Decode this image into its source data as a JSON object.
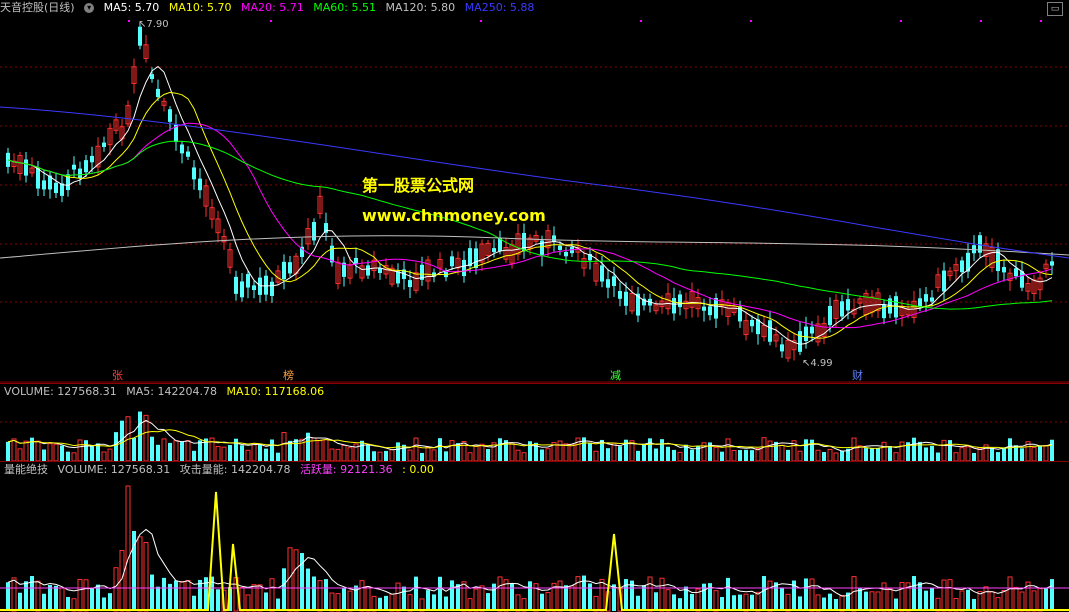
{
  "price_header": {
    "stock_name": "天音控股(日线)",
    "ma5": "MA5: 5.70",
    "ma10": "MA10: 5.70",
    "ma20": "MA20: 5.71",
    "ma60": "MA60: 5.51",
    "ma120": "MA120: 5.80",
    "ma250": "MA250: 5.88"
  },
  "high_marker": "7.90",
  "low_marker": "4.99",
  "watermark": {
    "line1": "第一股票公式网",
    "line2": "www.chnmoney.com"
  },
  "events": [
    {
      "label": "张",
      "color": "#ff4040"
    },
    {
      "label": "榜",
      "color": "#ffa040"
    },
    {
      "label": "减",
      "color": "#40ff40"
    },
    {
      "label": "财",
      "color": "#6080ff"
    }
  ],
  "volume_header": {
    "volume": "VOLUME: 127568.31",
    "ma5": "MA5: 142204.78",
    "ma10": "MA10: 117168.06"
  },
  "indicator_header": {
    "name": "量能绝技",
    "volume": "VOLUME: 127568.31",
    "attack": "攻击量能: 142204.78",
    "active": "活跃量: 92121.36",
    "extra": ": 0.00"
  },
  "colors": {
    "up": "#ff3030",
    "down": "#54ffff",
    "ma5": "#ffffff",
    "ma10": "#ffff00",
    "ma20": "#ff00ff",
    "ma60": "#00ff00",
    "ma120": "#c0c0c0",
    "ma250": "#3a3aff",
    "grid": "#8b0000"
  }
}
